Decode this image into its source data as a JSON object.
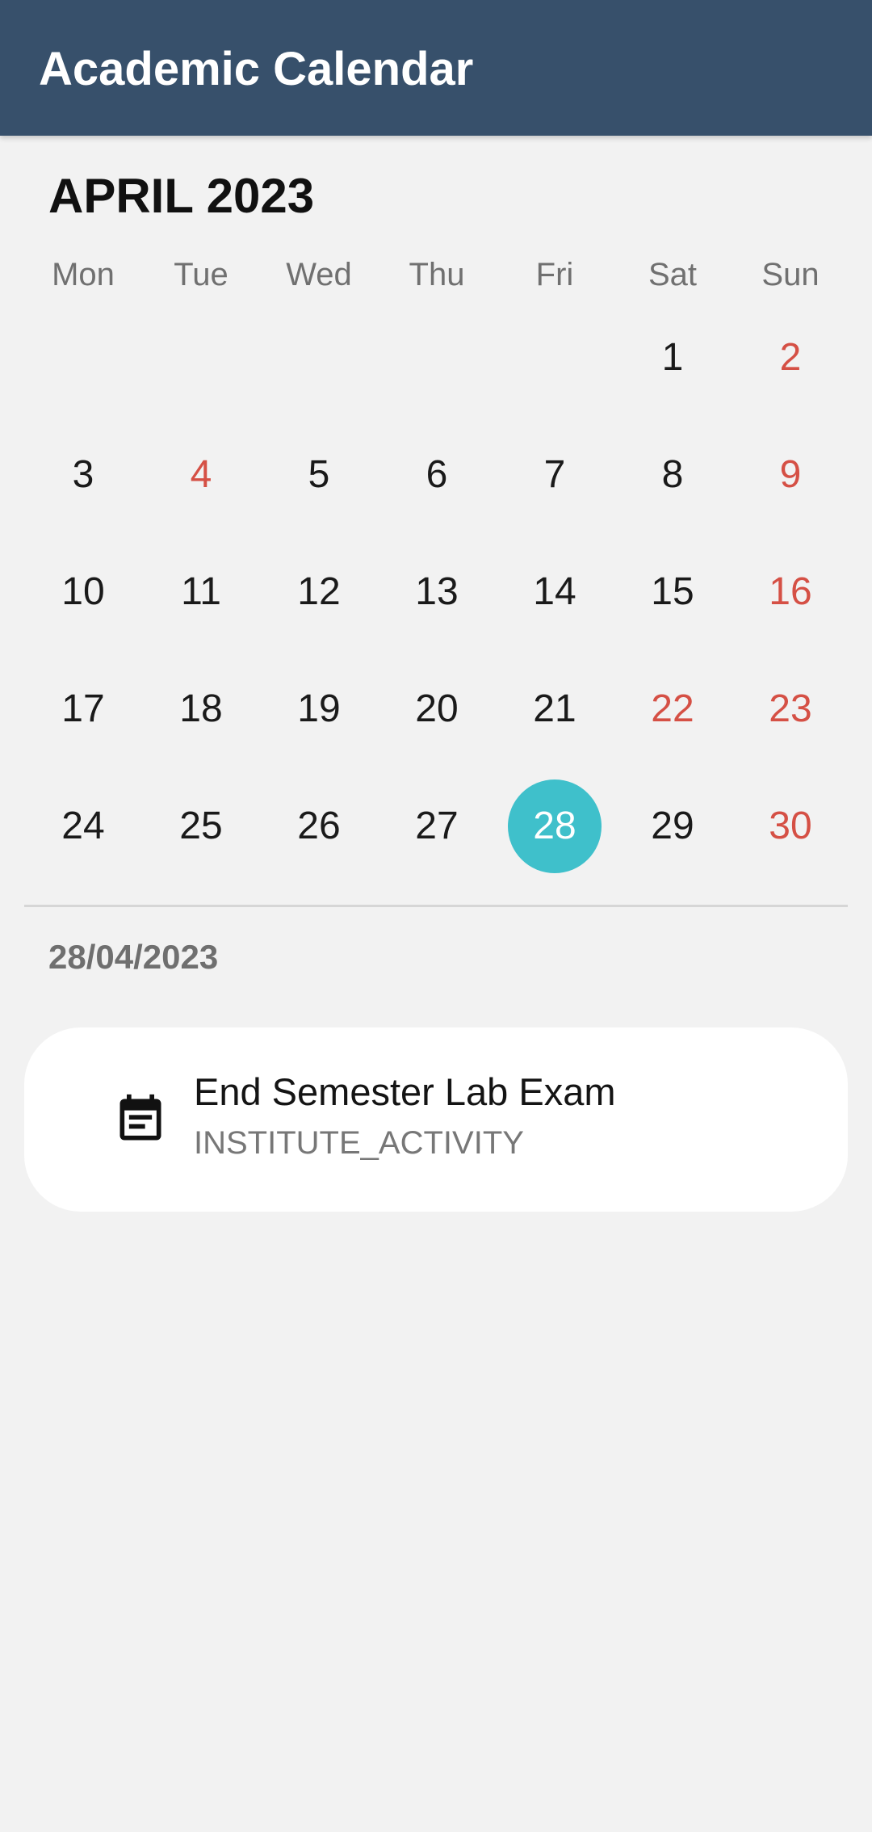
{
  "app_bar": {
    "title": "Academic Calendar",
    "background": "#37506b"
  },
  "calendar": {
    "month_label": "APRIL 2023",
    "weekdays": [
      "Mon",
      "Tue",
      "Wed",
      "Thu",
      "Fri",
      "Sat",
      "Sun"
    ],
    "weeks": [
      [
        "",
        "",
        "",
        "",
        "",
        "1",
        "2"
      ],
      [
        "3",
        "4",
        "5",
        "6",
        "7",
        "8",
        "9"
      ],
      [
        "10",
        "11",
        "12",
        "13",
        "14",
        "15",
        "16"
      ],
      [
        "17",
        "18",
        "19",
        "20",
        "21",
        "22",
        "23"
      ],
      [
        "24",
        "25",
        "26",
        "27",
        "28",
        "29",
        "30"
      ]
    ],
    "holidays": [
      "2",
      "4",
      "9",
      "16",
      "22",
      "23",
      "30"
    ],
    "selected_day": "28",
    "holiday_color": "#d55045",
    "selected_color": "#3fc0cb"
  },
  "events_section": {
    "selected_date": "28/04/2023",
    "events": [
      {
        "title": "End Semester Lab Exam",
        "type": "INSTITUTE_ACTIVITY",
        "icon": "event-note-icon"
      }
    ]
  }
}
